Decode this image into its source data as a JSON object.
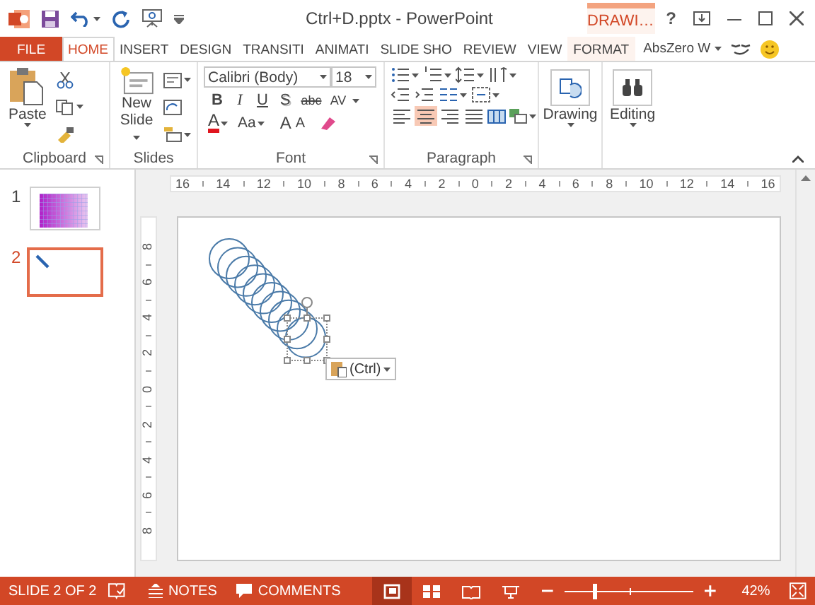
{
  "window": {
    "title": "Ctrl+D.pptx - PowerPoint",
    "contextual_header": "DRAWI…",
    "help": "?"
  },
  "tabs": [
    {
      "label": "FILE",
      "kind": "file",
      "selected": false
    },
    {
      "label": "HOME",
      "kind": "tab",
      "selected": true
    },
    {
      "label": "INSERT",
      "kind": "tab",
      "selected": false
    },
    {
      "label": "DESIGN",
      "kind": "tab",
      "selected": false
    },
    {
      "label": "TRANSITI",
      "kind": "tab",
      "selected": false
    },
    {
      "label": "ANIMATI",
      "kind": "tab",
      "selected": false
    },
    {
      "label": "SLIDE SHO",
      "kind": "tab",
      "selected": false
    },
    {
      "label": "REVIEW",
      "kind": "tab",
      "selected": false
    },
    {
      "label": "VIEW",
      "kind": "tab",
      "selected": false
    },
    {
      "label": "FORMAT",
      "kind": "contextual",
      "selected": false
    }
  ],
  "account": "AbsZero W",
  "ribbon": {
    "clipboard": {
      "label": "Clipboard",
      "paste": "Paste"
    },
    "slides": {
      "label": "Slides",
      "new_slide": [
        "New",
        "Slide"
      ]
    },
    "font": {
      "label": "Font",
      "font_name": "Calibri (Body)",
      "font_size": "18",
      "format_buttons": [
        "B",
        "I",
        "U",
        "S",
        "abc",
        "AV"
      ],
      "color_button": "A",
      "case_button": "Aa",
      "grow_button": "A",
      "shrink_button": "A"
    },
    "paragraph": {
      "label": "Paragraph",
      "align_buttons": [
        {
          "selected": false
        },
        {
          "selected": true
        },
        {
          "selected": false
        },
        {
          "selected": false
        }
      ]
    },
    "drawing": "Drawing",
    "editing": "Editing"
  },
  "thumbnails": [
    {
      "number": "1",
      "kind": "gradient",
      "selected": false
    },
    {
      "number": "2",
      "kind": "pen",
      "selected": true
    }
  ],
  "rulers": {
    "horizontal": [
      "16",
      "14",
      "12",
      "10",
      "8",
      "6",
      "4",
      "2",
      "0",
      "2",
      "4",
      "6",
      "8",
      "10",
      "12",
      "14",
      "16"
    ],
    "vertical": [
      "8",
      "6",
      "4",
      "2",
      "0",
      "2",
      "4",
      "6",
      "8"
    ]
  },
  "paste_options": "(Ctrl)",
  "status_bar": {
    "slide": "SLIDE 2 OF 2",
    "notes": "NOTES",
    "comments": "COMMENTS",
    "views": [
      {
        "kind": "normal",
        "selected": true
      },
      {
        "kind": "sorter",
        "selected": false
      },
      {
        "kind": "reading",
        "selected": false
      },
      {
        "kind": "slideshow",
        "selected": false
      }
    ],
    "zoom": {
      "level": 0.23,
      "reading": "42%"
    }
  }
}
